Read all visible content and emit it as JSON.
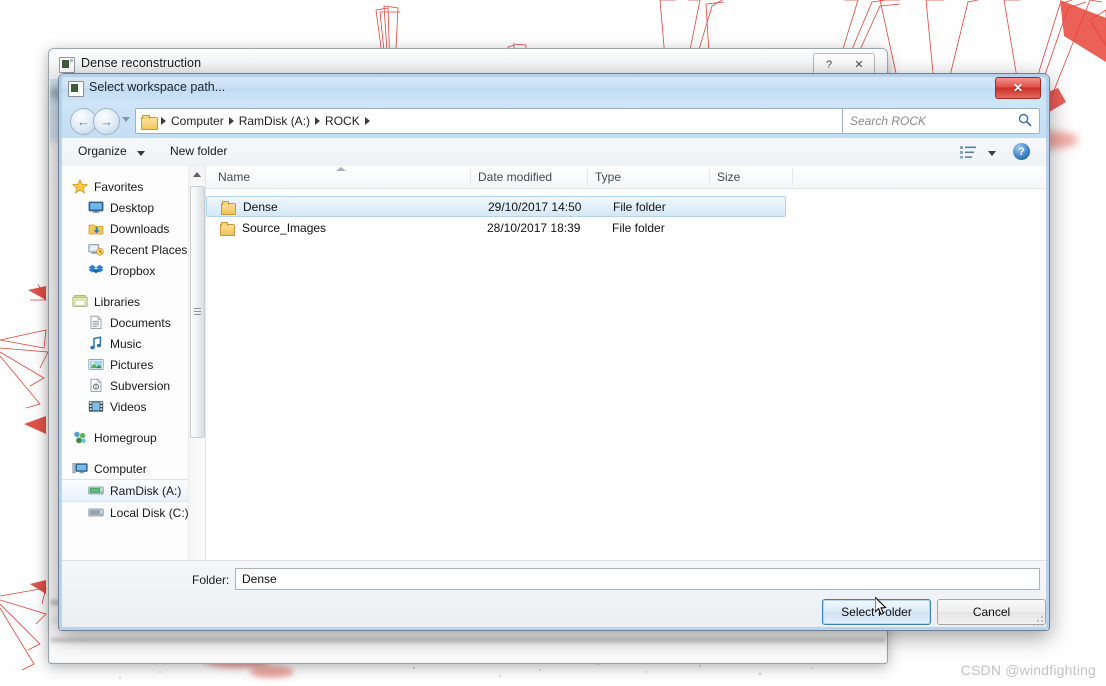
{
  "viewer": {
    "name": "3d-reconstruction-viewport",
    "accent_color": "#e03a2f",
    "background_color": "#fefefe"
  },
  "outer_dialog": {
    "title": "Dense reconstruction",
    "help_label": "?",
    "close_label": "✕"
  },
  "file_dialog": {
    "title": "Select workspace path...",
    "close_label": "✕",
    "nav": {
      "back_label": "←",
      "forward_label": "→",
      "refresh_label": "↻",
      "breadcrumbs": [
        "Computer",
        "RamDisk (A:)",
        "ROCK"
      ]
    },
    "search": {
      "placeholder": "Search ROCK",
      "value": ""
    },
    "toolbar": {
      "organize_label": "Organize",
      "new_folder_label": "New folder",
      "help_label": "?"
    },
    "nav_pane": {
      "sections": [
        {
          "header": "Favorites",
          "items": [
            "Desktop",
            "Downloads",
            "Recent Places",
            "Dropbox"
          ]
        },
        {
          "header": "Libraries",
          "items": [
            "Documents",
            "Music",
            "Pictures",
            "Subversion",
            "Videos"
          ]
        },
        {
          "header": "Homegroup",
          "items": []
        },
        {
          "header": "Computer",
          "items": [
            "RamDisk (A:)",
            "Local Disk (C:)"
          ]
        }
      ],
      "selected": "RamDisk (A:)"
    },
    "list": {
      "columns": [
        "Name",
        "Date modified",
        "Type",
        "Size"
      ],
      "sorted_by": "Name",
      "rows": [
        {
          "name": "Dense",
          "date_modified": "29/10/2017 14:50",
          "type": "File folder",
          "size": "",
          "selected": true
        },
        {
          "name": "Source_Images",
          "date_modified": "28/10/2017 18:39",
          "type": "File folder",
          "size": "",
          "selected": false
        }
      ]
    },
    "footer": {
      "folder_label": "Folder:",
      "folder_value": "Dense",
      "select_button": "Select Folder",
      "cancel_button": "Cancel"
    }
  },
  "watermark": "CSDN @windfighting"
}
